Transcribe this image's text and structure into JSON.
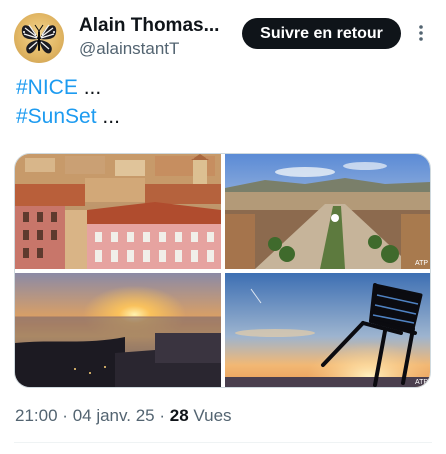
{
  "author": {
    "name": "Alain Thomas...",
    "handle": "@alainstantT",
    "avatar_icon": "butterfly-icon"
  },
  "follow_button": {
    "label": "Suivre en retour"
  },
  "more_icon": "more-vertical-icon",
  "tweet_text": {
    "line1": {
      "hashtag": "#NICE",
      "suffix": " ..."
    },
    "line2": {
      "hashtag": "#SunSet",
      "suffix": " ..."
    }
  },
  "media": {
    "images": [
      {
        "name": "nice-rooftops-photo",
        "watermark": ""
      },
      {
        "name": "nice-city-aerial-photo",
        "watermark": "ATP"
      },
      {
        "name": "sea-sunset-photo",
        "watermark": ""
      },
      {
        "name": "chair-silhouette-sunset-photo",
        "watermark": "ATP"
      }
    ]
  },
  "meta": {
    "time": "21:00",
    "separator": "·",
    "date": "04 janv. 25",
    "views_count": "28",
    "views_label": "Vues"
  },
  "colors": {
    "text_primary": "#0f1419",
    "text_secondary": "#536471",
    "hashtag": "#1d9bf0",
    "button_bg": "#0f1419",
    "button_text": "#ffffff"
  }
}
